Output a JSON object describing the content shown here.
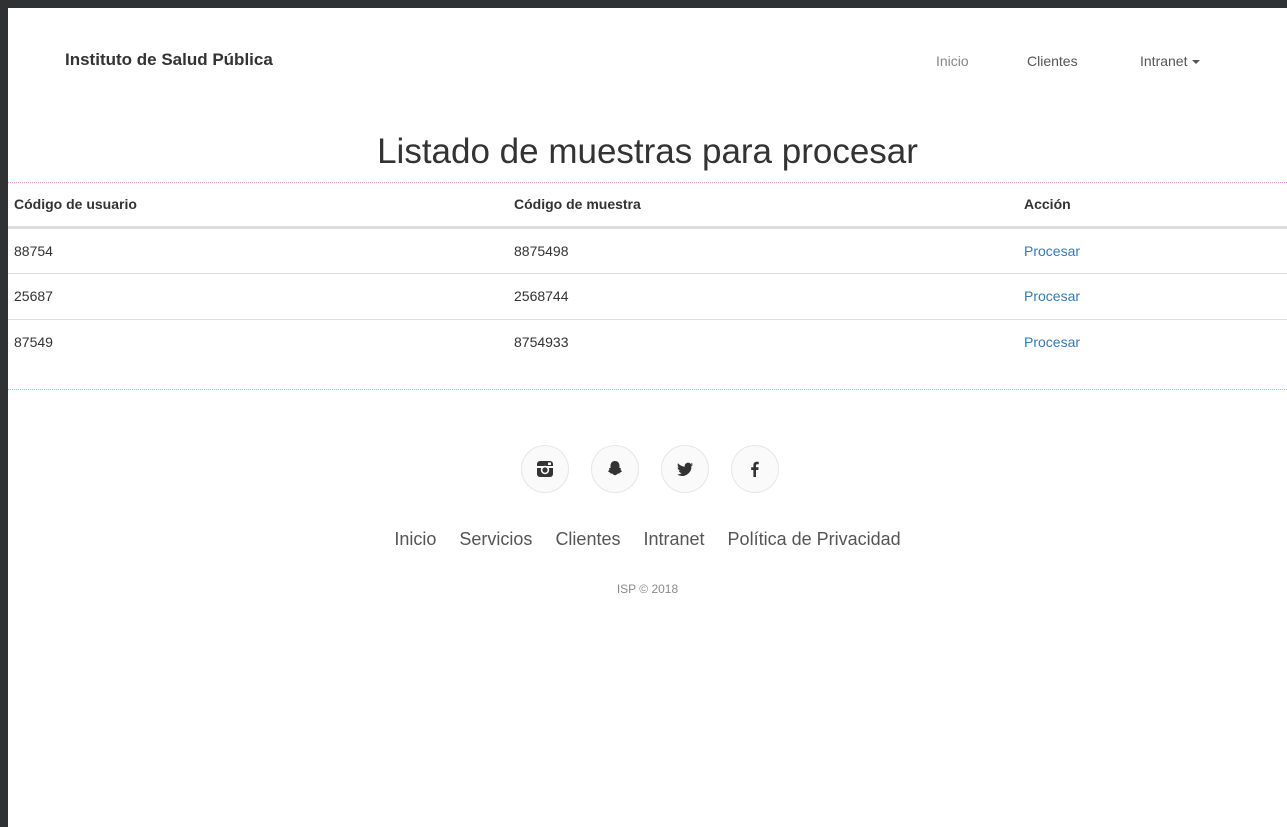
{
  "navbar": {
    "brand": "Instituto de Salud Pública",
    "links": [
      {
        "label": "Inicio"
      },
      {
        "label": "Clientes"
      },
      {
        "label": "Intranet"
      }
    ]
  },
  "main": {
    "title": "Listado de muestras para procesar",
    "table": {
      "headers": [
        "Código de usuario",
        "Código de muestra",
        "Acción"
      ],
      "rows": [
        {
          "user_code": "88754",
          "sample_code": "8875498",
          "action": "Procesar"
        },
        {
          "user_code": "25687",
          "sample_code": "2568744",
          "action": "Procesar"
        },
        {
          "user_code": "87549",
          "sample_code": "8754933",
          "action": "Procesar"
        }
      ]
    }
  },
  "footer": {
    "social_icons": [
      "instagram-icon",
      "snapchat-icon",
      "twitter-icon",
      "facebook-icon"
    ],
    "links": [
      {
        "label": "Inicio"
      },
      {
        "label": "Servicios"
      },
      {
        "label": "Clientes"
      },
      {
        "label": "Intranet"
      },
      {
        "label": "Política de Privacidad"
      }
    ],
    "copyright": "ISP © 2018"
  },
  "colors": {
    "link": "#337ab7",
    "text": "#333333",
    "frame": "#2f3133",
    "table_guides": "#e58fe0"
  }
}
